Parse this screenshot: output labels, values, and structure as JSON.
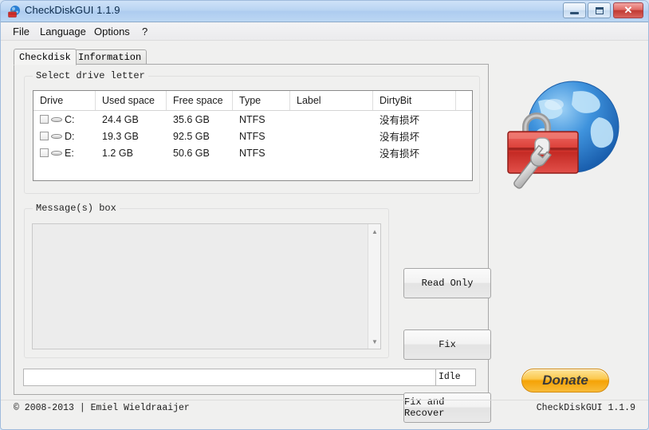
{
  "window": {
    "title": "CheckDiskGUI 1.1.9",
    "icon": "globe-toolbox-icon",
    "controls": {
      "minimize": "minimize-button",
      "maximize": "maximize-button",
      "close": "close-button"
    }
  },
  "menubar": {
    "items": [
      {
        "label": "File"
      },
      {
        "label": "Language"
      },
      {
        "label": "Options"
      },
      {
        "label": "?"
      }
    ]
  },
  "tabs": [
    {
      "label": "Checkdisk",
      "selected": true
    },
    {
      "label": "Information",
      "selected": false
    }
  ],
  "drives_group": {
    "caption": "Select drive letter",
    "columns": [
      "Drive",
      "Used space",
      "Free space",
      "Type",
      "Label",
      "DirtyBit"
    ],
    "rows": [
      {
        "checked": false,
        "drive": "C:",
        "used": "24.4 GB",
        "free": "35.6 GB",
        "type": "NTFS",
        "label": "",
        "dirtybit": "没有损坏"
      },
      {
        "checked": false,
        "drive": "D:",
        "used": "19.3 GB",
        "free": "92.5 GB",
        "type": "NTFS",
        "label": "",
        "dirtybit": "没有损坏"
      },
      {
        "checked": false,
        "drive": "E:",
        "used": "1.2 GB",
        "free": "50.6 GB",
        "type": "NTFS",
        "label": "",
        "dirtybit": "没有损坏"
      }
    ]
  },
  "messages_group": {
    "caption": "Message(s) box",
    "textarea_value": "",
    "scrollbar": {
      "up": "▲",
      "down": "▼"
    }
  },
  "actions": {
    "read_only": "Read Only",
    "fix": "Fix",
    "fix_and_recover": "Fix and Recover"
  },
  "statusbar": {
    "left_text": "",
    "right_text": "Idle"
  },
  "donate": {
    "label": "Donate"
  },
  "footer": {
    "left": "© 2008-2013 | Emiel Wieldraaijer",
    "right": "CheckDiskGUI 1.1.9"
  },
  "colors": {
    "title_bar": "#b9d4f2",
    "close_button": "#c03a33",
    "panel_bg": "#f0f0ef",
    "donate_orange": "#f5a306",
    "globe_blue": "#2a7fd4",
    "toolbox_red": "#d3322f"
  }
}
